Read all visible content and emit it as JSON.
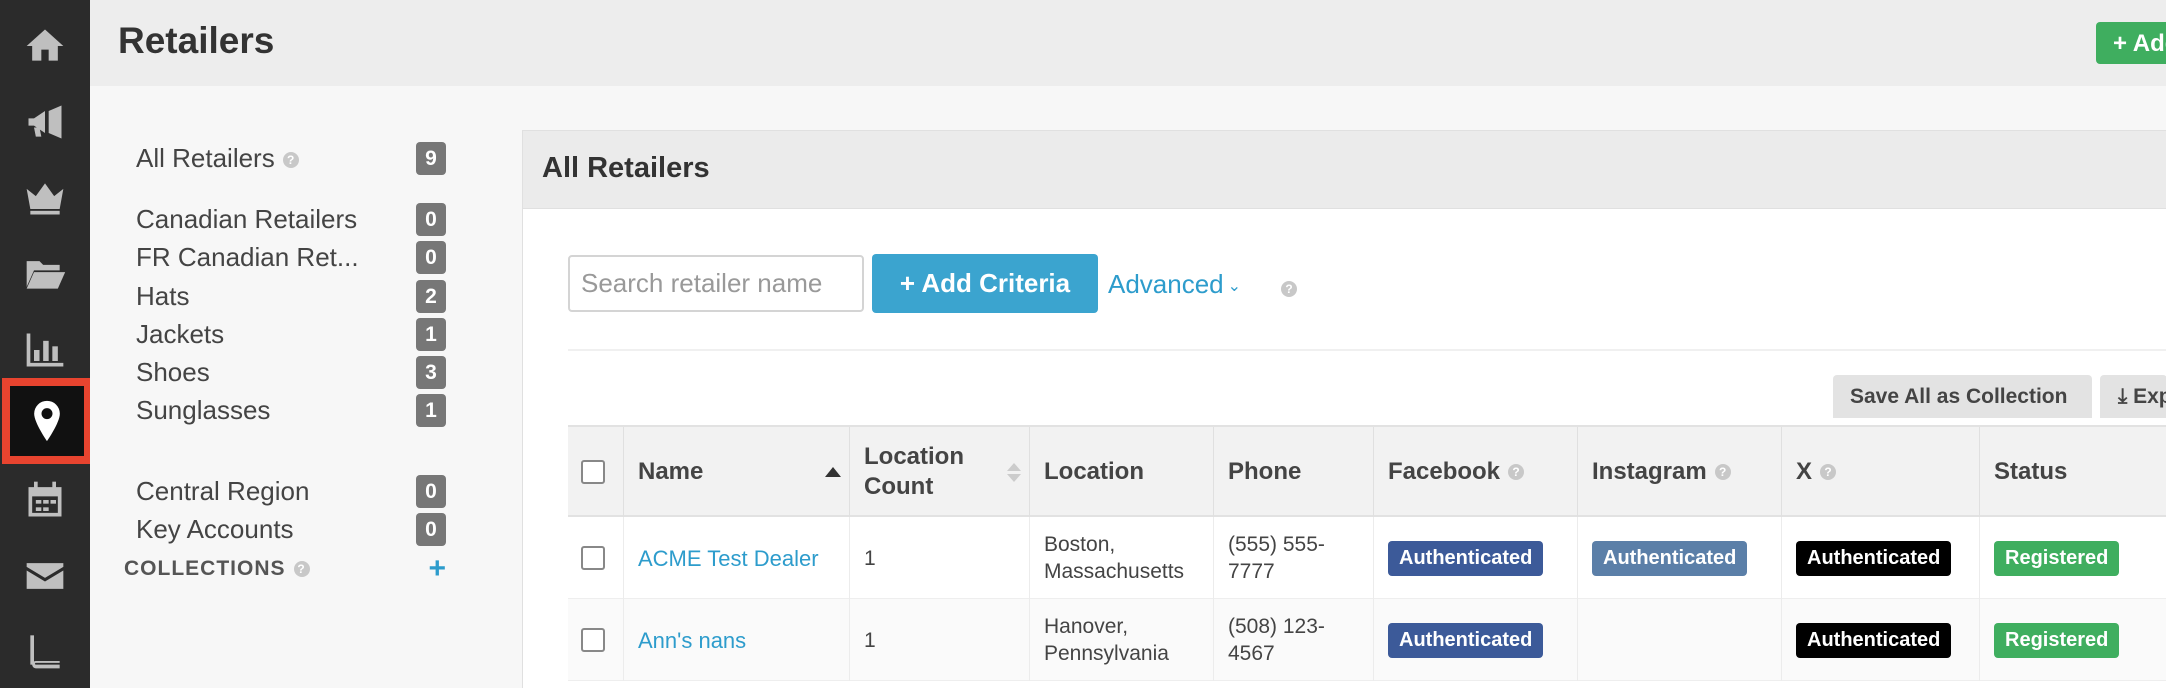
{
  "nav": {
    "items": [
      {
        "name": "home-icon"
      },
      {
        "name": "megaphone-icon"
      },
      {
        "name": "crown-icon"
      },
      {
        "name": "folder-icon"
      },
      {
        "name": "bar-chart-icon"
      },
      {
        "name": "map-pin-icon",
        "active": true
      },
      {
        "name": "calendar-icon"
      },
      {
        "name": "envelope-icon"
      },
      {
        "name": "book-icon"
      }
    ],
    "active_color": "#e8442f"
  },
  "header": {
    "title": "Retailers",
    "add_button_label": "+ Add"
  },
  "collections_sidebar": {
    "all": {
      "label": "All Retailers",
      "count": "9"
    },
    "groups": [
      {
        "label": "Canadian Retailers",
        "count": "0"
      },
      {
        "label": "FR Canadian Ret...",
        "count": "0"
      },
      {
        "label": "Hats",
        "count": "2"
      },
      {
        "label": "Jackets",
        "count": "1"
      },
      {
        "label": "Shoes",
        "count": "3"
      },
      {
        "label": "Sunglasses",
        "count": "1"
      }
    ],
    "collections_heading": "COLLECTIONS",
    "collections": [
      {
        "label": "Central Region",
        "count": "0"
      },
      {
        "label": "Key Accounts",
        "count": "0"
      }
    ]
  },
  "panel": {
    "title": "All Retailers",
    "search_placeholder": "Search retailer name",
    "add_criteria_label": "+ Add Criteria",
    "advanced_label": "Advanced",
    "save_collection_label": "Save All as Collection",
    "export_label": "Export"
  },
  "table": {
    "columns": {
      "name": "Name",
      "location_count": "Location Count",
      "location": "Location",
      "phone": "Phone",
      "facebook": "Facebook",
      "instagram": "Instagram",
      "x": "X",
      "status": "Status"
    },
    "rows": [
      {
        "name": "ACME Test Dealer",
        "location_count": "1",
        "location": "Boston, Massachusetts",
        "phone": "(555) 555-7777",
        "facebook": "Authenticated",
        "instagram": "Authenticated",
        "x": "Authenticated",
        "status": "Registered"
      },
      {
        "name": "Ann's nans",
        "location_count": "1",
        "location": "Hanover, Pennsylvania",
        "phone": "(508) 123-4567",
        "facebook": "Authenticated",
        "instagram": "",
        "x": "Authenticated",
        "status": "Registered"
      }
    ]
  },
  "colors": {
    "facebook_badge": "#3c5a99",
    "instagram_badge": "#5b7fa8",
    "x_badge": "#000000",
    "status_badge": "#3fae5f",
    "link": "#2d9ccc",
    "primary_button": "#3ba4cf"
  }
}
